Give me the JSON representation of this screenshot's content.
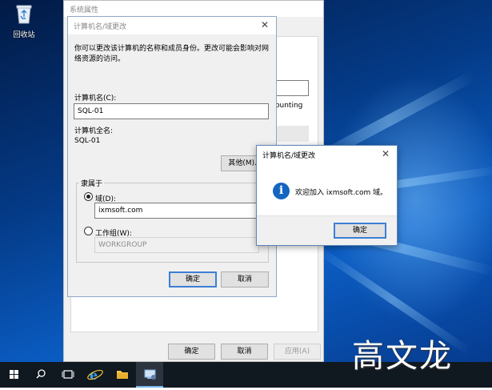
{
  "desktop": {
    "recycle_bin_label": "回收站"
  },
  "system_properties": {
    "title": "系统属性",
    "partial_text": "ounting",
    "ok_label": "确定",
    "cancel_label": "取消",
    "apply_label": "应用(A)"
  },
  "computer_name_dialog": {
    "title": "计算机名/域更改",
    "description": "你可以更改该计算机的名称和成员身份。更改可能会影响对网络资源的访问。",
    "computer_name_label": "计算机名(C):",
    "computer_name_value": "SQL-01",
    "full_name_label": "计算机全名:",
    "full_name_value": "SQL-01",
    "more_button": "其他(M)...",
    "member_of_label": "隶属于",
    "domain_radio_label": "域(D):",
    "domain_value": "ixmsoft.com",
    "workgroup_radio_label": "工作组(W):",
    "workgroup_value": "WORKGROUP",
    "ok_label": "确定",
    "cancel_label": "取消"
  },
  "welcome_dialog": {
    "title": "计算机名/域更改",
    "message": "欢迎加入 ixmsoft.com 域。",
    "ok_label": "确定"
  },
  "watermark": "高文龙",
  "colors": {
    "accent": "#3c7fd6",
    "info_icon": "#1565c0",
    "taskbar": "#101820"
  }
}
